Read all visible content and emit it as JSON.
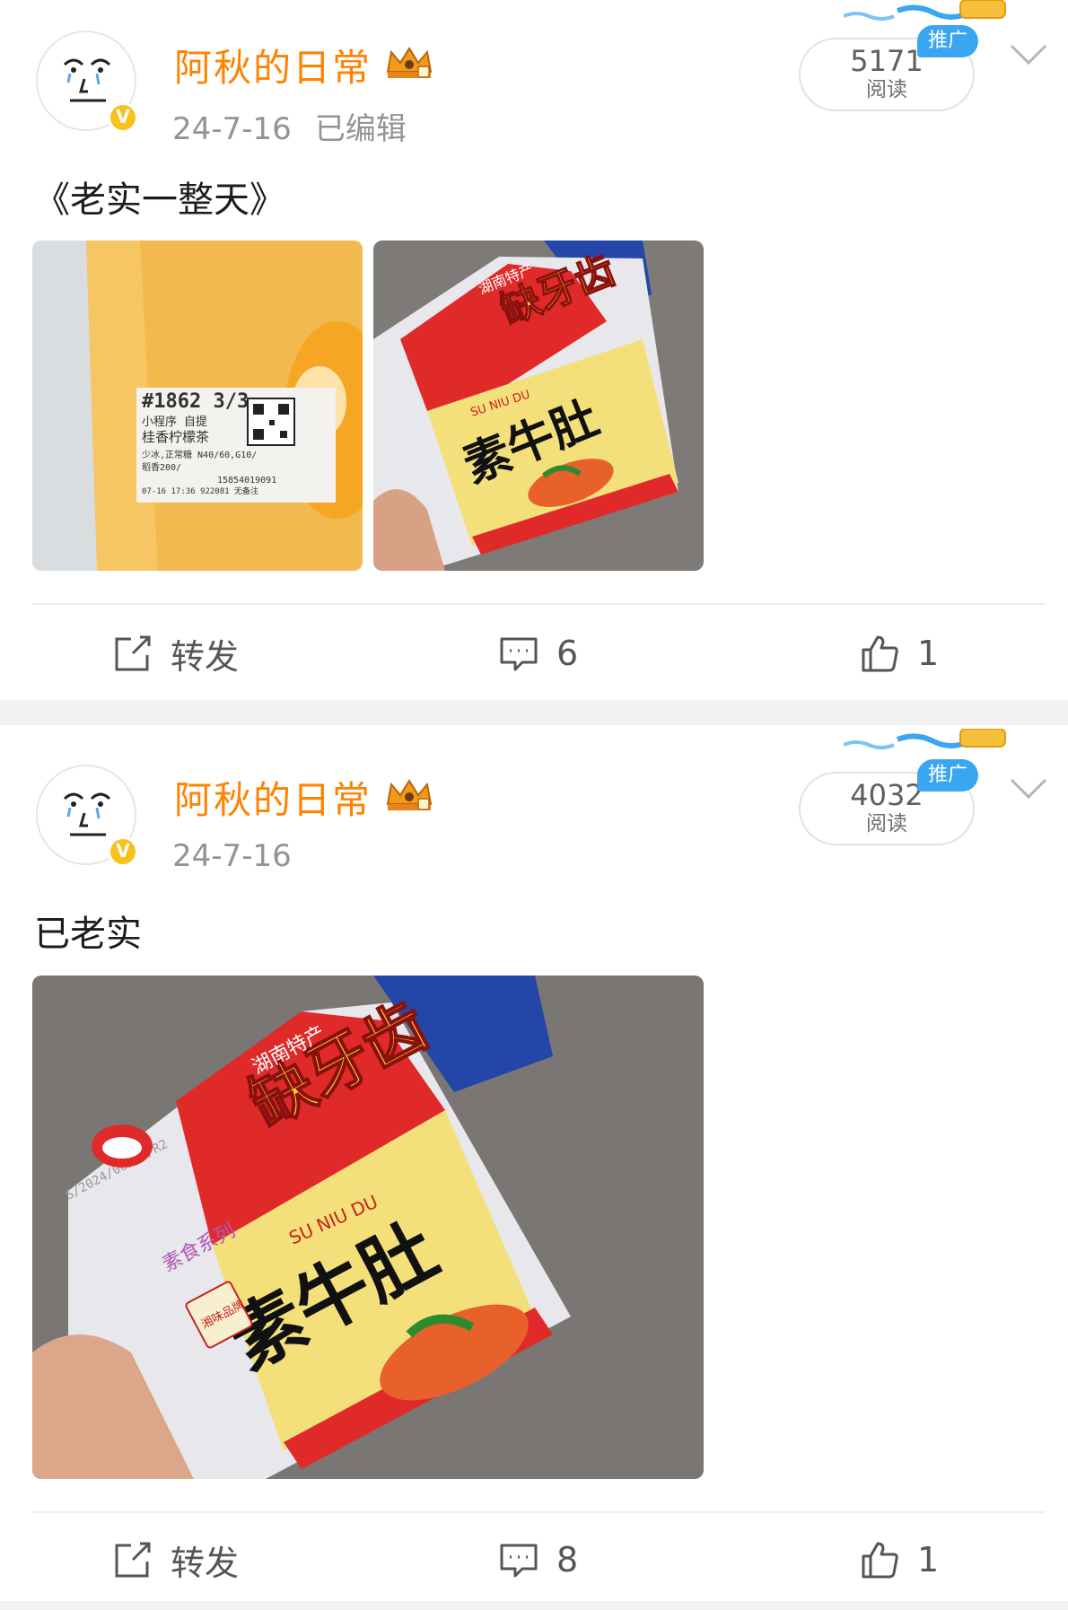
{
  "posts": [
    {
      "author": "阿秋的日常",
      "date": "24-7-16",
      "edited": "已编辑",
      "read_count": "5171",
      "read_label": "阅读",
      "promo": "推广",
      "text": "《老实一整天》",
      "images": [
        {
          "type": "cup",
          "label_lines": [
            "#1862 3/3",
            "小程序 自提",
            "桂香柠檬茶",
            "少冰,正常糖 N40/60,G10/",
            "稻香200/",
            "07-16 17:36 922081 无备注",
            "15854019091"
          ]
        },
        {
          "type": "snack",
          "brand": "缺牙齿",
          "name": "素牛肚",
          "pinyin": "SU NIU DU",
          "region": "湖南特产"
        }
      ],
      "actions": {
        "repost": "转发",
        "comments": "6",
        "likes": "1"
      }
    },
    {
      "author": "阿秋的日常",
      "date": "24-7-16",
      "edited": "",
      "read_count": "4032",
      "read_label": "阅读",
      "promo": "推广",
      "text": "已老实",
      "images": [
        {
          "type": "snack",
          "brand": "缺牙齿",
          "name": "素牛肚",
          "pinyin": "SU NIU DU",
          "region": "湖南特产",
          "series": "素食系列",
          "stamp": "湘味品牌",
          "date_code": "S/2024/06/25/R2"
        }
      ],
      "actions": {
        "repost": "转发",
        "comments": "8",
        "likes": "1"
      }
    }
  ],
  "colors": {
    "accent": "#ff8200",
    "promo": "#3aa5f0",
    "verified": "#f6c21b",
    "muted": "#939393"
  },
  "icons": [
    "verified-badge-icon",
    "crown-icon",
    "chevron-down-icon",
    "repost-icon",
    "comment-icon",
    "like-icon"
  ]
}
